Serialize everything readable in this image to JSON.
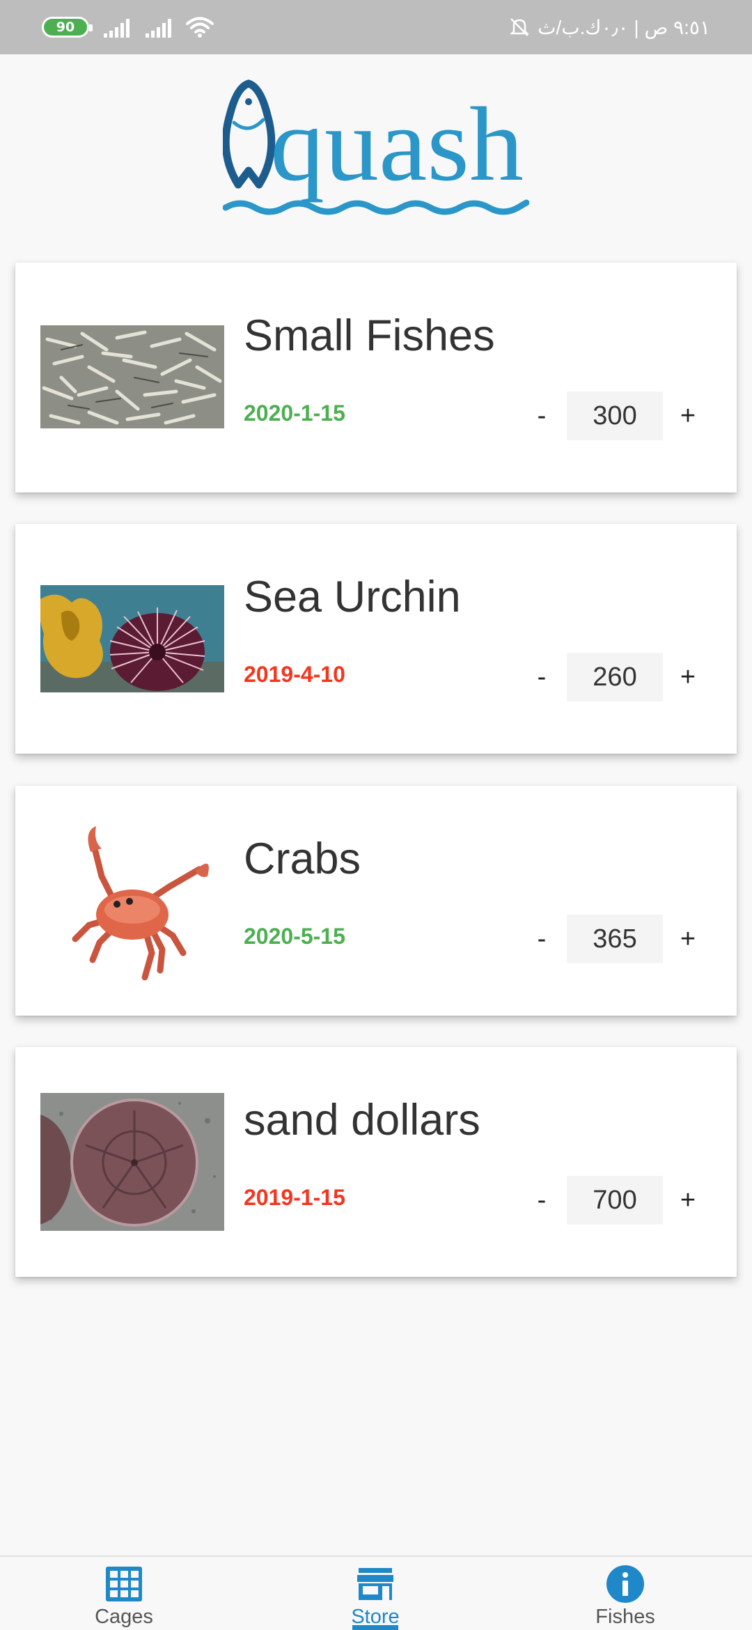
{
  "status_bar": {
    "battery": "90",
    "right_text": "٩:٥١ ص | ٠٫٠ك.ب/ث"
  },
  "logo": {
    "text": "quash"
  },
  "items": [
    {
      "name": "Small Fishes",
      "date": "2020-1-15",
      "date_color": "#4caf50",
      "quantity": "300",
      "image": "small-fishes-image"
    },
    {
      "name": "Sea Urchin",
      "date": "2019-4-10",
      "date_color": "#f4361e",
      "quantity": "260",
      "image": "sea-urchin-image"
    },
    {
      "name": "Crabs",
      "date": "2020-5-15",
      "date_color": "#4caf50",
      "quantity": "365",
      "image": "crab-image"
    },
    {
      "name": "sand dollars",
      "date": "2019-1-15",
      "date_color": "#f4361e",
      "quantity": "700",
      "image": "sand-dollar-image"
    }
  ],
  "qty_controls": {
    "minus": "-",
    "plus": "+"
  },
  "nav": {
    "items": [
      {
        "label": "Cages",
        "icon": "grid-icon",
        "active": false
      },
      {
        "label": "Store",
        "icon": "store-icon",
        "active": true
      },
      {
        "label": "Fishes",
        "icon": "info-icon",
        "active": false
      }
    ],
    "accent": "#1e88c8"
  }
}
